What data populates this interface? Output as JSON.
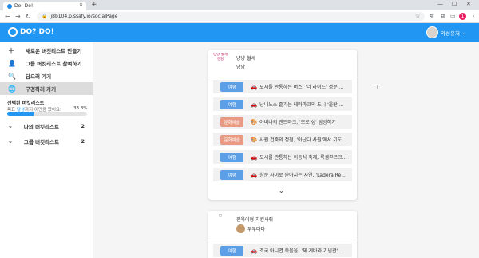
{
  "browser": {
    "tab_title": "Do! Do!",
    "url": "j8b104.p.ssafy.io/socialPage",
    "profile_initial": "1"
  },
  "app": {
    "logo_text": "DO? DO!",
    "user_name": "악성유저"
  },
  "sidebar": {
    "items": [
      {
        "label": "새로운 버킷리스트 만들기",
        "icon": "plus-icon"
      },
      {
        "label": "그룹 버킷리스트 참여하기",
        "icon": "user-add-icon"
      },
      {
        "label": "담으러 가기",
        "icon": "search-icon"
      },
      {
        "label": "구경하러 가기",
        "icon": "globe-icon"
      }
    ],
    "selected": {
      "title": "선택된 버킷리스트",
      "desc_prefix": "목표 ",
      "desc_highlight": "달성",
      "desc_suffix": "까지 이만큼 왔어요!",
      "percent_label": "33.3%",
      "progress": 0.333
    },
    "groups": [
      {
        "label": "나의 버킷리스트",
        "count": "2"
      },
      {
        "label": "그룹 버킷리스트",
        "count": "2"
      }
    ]
  },
  "colors": {
    "primary": "#2196f3",
    "travel": "#5c9fe6",
    "culture": "#e89a84"
  },
  "cards": [
    {
      "group_img_text": "냥냥 혈세 엔딩",
      "group_name": "냥냥 혈세",
      "member": "냥냥",
      "items": [
        {
          "badge": "여행",
          "type": "travel",
          "icon": "car-icon",
          "text": "도시를 관통하는 버스, '더 라이드' 정문 ..."
        },
        {
          "badge": "여행",
          "type": "travel",
          "icon": "car-icon",
          "text": "낭니노스 즐기는 테마파크의 도시 '올란'..."
        },
        {
          "badge": "문화예술",
          "type": "culture",
          "icon": "palette-icon",
          "text": "아비나의 랜드마크, '모로 성' 탐방하기"
        },
        {
          "badge": "문화예술",
          "type": "culture",
          "icon": "palette-icon",
          "text": "사원 건축의 정점, '아난다 사원'에서 기도..."
        },
        {
          "badge": "여행",
          "type": "travel",
          "icon": "car-icon",
          "text": "도시를 관통하는 이동식 축제, 록셈부르크..."
        },
        {
          "badge": "여행",
          "type": "travel",
          "icon": "car-icon",
          "text": "창문 사이로 쏟아지는 자연, 'Ladera Re..."
        }
      ]
    },
    {
      "group_name": "진육이형 치킨사줘",
      "member": "두두다다",
      "items": [
        {
          "badge": "여행",
          "type": "travel",
          "icon": "car-icon",
          "text": "조국 아니면 죽음을! '체 게바라 기념관' ..."
        }
      ]
    }
  ]
}
